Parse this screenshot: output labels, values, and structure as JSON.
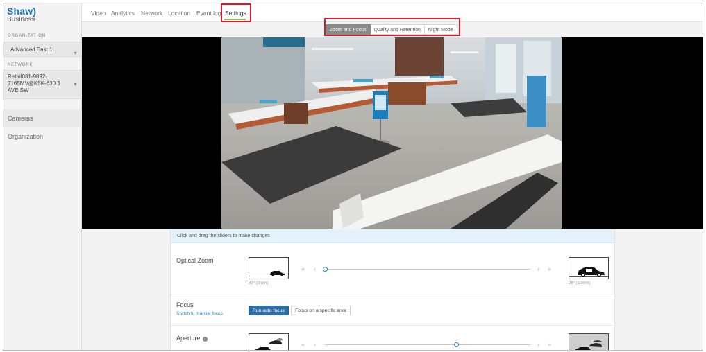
{
  "brand": {
    "name": "Shaw)",
    "subtitle": "Business"
  },
  "sidebar": {
    "organization_label": "ORGANIZATION",
    "organization_value": ". Advanced East 1",
    "network_label": "NETWORK",
    "network_value": "Retail031-9892-7165MV@K5K-630 3 AVE SW",
    "nav": [
      {
        "label": "Cameras",
        "active": true
      },
      {
        "label": "Organization",
        "active": false
      }
    ]
  },
  "tabs": [
    "Video",
    "Analytics",
    "Network",
    "Location",
    "Event log",
    "Settings"
  ],
  "active_tab": "Settings",
  "subtabs": [
    "Zoom and Focus",
    "Quality and Retention",
    "Night Mode"
  ],
  "active_subtab": "Zoom and Focus",
  "controls": {
    "hint": "Click and drag the sliders to make changes",
    "optical_zoom": {
      "label": "Optical Zoom",
      "min_caption": "82° (3mm)",
      "max_caption": "28° (10mm)",
      "level": 0.0
    },
    "focus": {
      "label": "Focus",
      "manual_link": "Switch to manual focus",
      "auto_button": "Run auto focus",
      "area_button": "Focus on a specific area"
    },
    "aperture": {
      "label": "Aperture",
      "level": 0.64
    }
  },
  "colors": {
    "highlight": "#d21f2e",
    "accent": "#2a7fc5",
    "tab_underline": "#8bc34a"
  }
}
